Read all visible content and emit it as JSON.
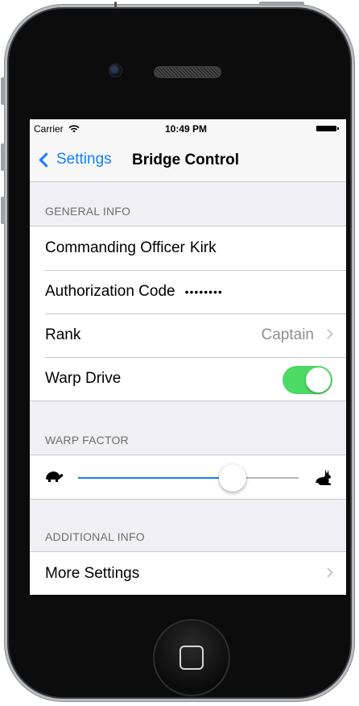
{
  "status_bar": {
    "carrier": "Carrier",
    "time": "10:49 PM",
    "icons": [
      "wifi-icon",
      "battery-icon"
    ]
  },
  "nav": {
    "back_label": "Settings",
    "title": "Bridge Control",
    "accent_color": "#157efb"
  },
  "general_info": {
    "header": "GENERAL INFO",
    "commanding_officer_label": "Commanding Officer",
    "commanding_officer_value": "Kirk",
    "authorization_code_label": "Authorization Code",
    "authorization_code_value": "••••••••",
    "rank_label": "Rank",
    "rank_value": "Captain",
    "warp_drive_label": "Warp Drive",
    "warp_drive_on": true,
    "toggle_color": "#4cd964"
  },
  "warp_factor": {
    "header": "WARP FACTOR",
    "min_icon": "turtle-icon",
    "max_icon": "rabbit-icon",
    "level": 0.7
  },
  "additional_info": {
    "header": "ADDITIONAL INFO",
    "more_settings_label": "More Settings"
  }
}
